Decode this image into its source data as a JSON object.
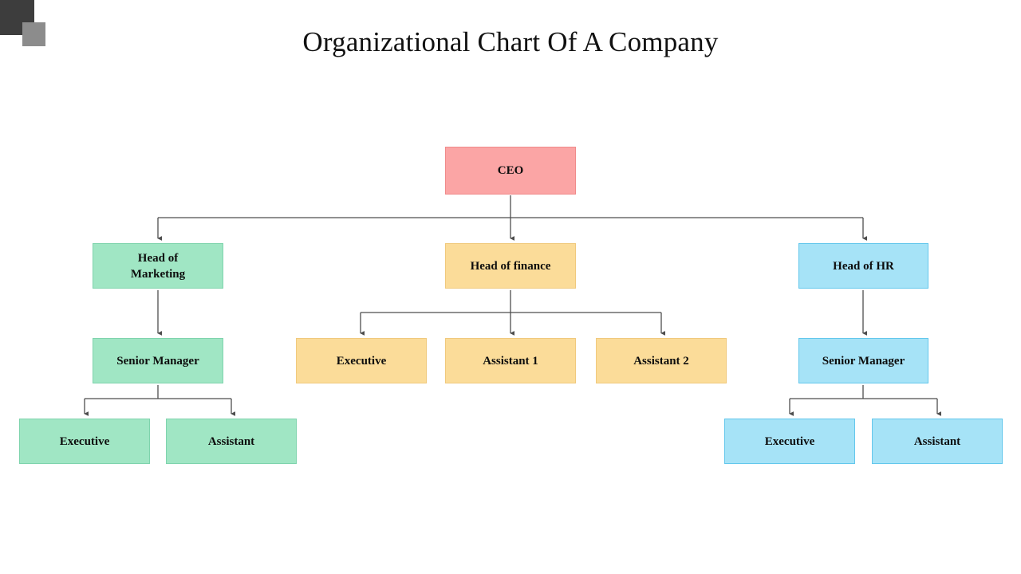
{
  "page": {
    "title": "Organizational Chart Of A Company",
    "background_color": "#ffffff"
  },
  "decoration": {
    "square_dark_color": "#3d3d3d",
    "square_gray_color": "#8c8c8c"
  },
  "palette": {
    "ceo_fill": "#fba5a5",
    "ceo_border": "#f08a8a",
    "marketing_fill": "#a0e6c4",
    "marketing_border": "#7fd4ad",
    "finance_fill": "#fbdc99",
    "finance_border": "#f0c97d",
    "hr_fill": "#a6e3f7",
    "hr_border": "#63c7ec",
    "connector_color": "#4d4d4d"
  },
  "chart_data": {
    "type": "diagram",
    "title": "Organizational Chart Of A Company",
    "nodes": [
      {
        "id": "ceo",
        "label": "CEO",
        "level": 0,
        "branch": "root",
        "color": "#fba5a5"
      },
      {
        "id": "marketing",
        "label": "Head of Marketing",
        "level": 1,
        "branch": "marketing",
        "color": "#a0e6c4"
      },
      {
        "id": "finance",
        "label": "Head of finance",
        "level": 1,
        "branch": "finance",
        "color": "#fbdc99"
      },
      {
        "id": "hr",
        "label": "Head of HR",
        "level": 1,
        "branch": "hr",
        "color": "#a6e3f7"
      },
      {
        "id": "mkt_sm",
        "label": "Senior Manager",
        "level": 2,
        "branch": "marketing",
        "color": "#a0e6c4"
      },
      {
        "id": "fin_exec",
        "label": "Executive",
        "level": 2,
        "branch": "finance",
        "color": "#fbdc99"
      },
      {
        "id": "fin_asst1",
        "label": "Assistant 1",
        "level": 2,
        "branch": "finance",
        "color": "#fbdc99"
      },
      {
        "id": "fin_asst2",
        "label": "Assistant 2",
        "level": 2,
        "branch": "finance",
        "color": "#fbdc99"
      },
      {
        "id": "hr_sm",
        "label": "Senior Manager",
        "level": 2,
        "branch": "hr",
        "color": "#a6e3f7"
      },
      {
        "id": "mkt_exec",
        "label": "Executive",
        "level": 3,
        "branch": "marketing",
        "color": "#a0e6c4"
      },
      {
        "id": "mkt_asst",
        "label": "Assistant",
        "level": 3,
        "branch": "marketing",
        "color": "#a0e6c4"
      },
      {
        "id": "hr_exec",
        "label": "Executive",
        "level": 3,
        "branch": "hr",
        "color": "#a6e3f7"
      },
      {
        "id": "hr_asst",
        "label": "Assistant",
        "level": 3,
        "branch": "hr",
        "color": "#a6e3f7"
      }
    ],
    "edges": [
      {
        "from": "ceo",
        "to": "marketing"
      },
      {
        "from": "ceo",
        "to": "finance"
      },
      {
        "from": "ceo",
        "to": "hr"
      },
      {
        "from": "marketing",
        "to": "mkt_sm"
      },
      {
        "from": "finance",
        "to": "fin_exec"
      },
      {
        "from": "finance",
        "to": "fin_asst1"
      },
      {
        "from": "finance",
        "to": "fin_asst2"
      },
      {
        "from": "hr",
        "to": "hr_sm"
      },
      {
        "from": "mkt_sm",
        "to": "mkt_exec"
      },
      {
        "from": "mkt_sm",
        "to": "mkt_asst"
      },
      {
        "from": "hr_sm",
        "to": "hr_exec"
      },
      {
        "from": "hr_sm",
        "to": "hr_asst"
      }
    ]
  },
  "nodes": {
    "ceo": {
      "label": "CEO"
    },
    "marketing": {
      "line1": "Head of",
      "line2": "Marketing"
    },
    "finance": {
      "label": "Head of finance"
    },
    "hr": {
      "label": "Head of HR"
    },
    "mkt_sm": {
      "label": "Senior Manager"
    },
    "fin_exec": {
      "label": "Executive"
    },
    "fin_asst1": {
      "label": "Assistant 1"
    },
    "fin_asst2": {
      "label": "Assistant 2"
    },
    "hr_sm": {
      "label": "Senior Manager"
    },
    "mkt_exec": {
      "label": "Executive"
    },
    "mkt_asst": {
      "label": "Assistant"
    },
    "hr_exec": {
      "label": "Executive"
    },
    "hr_asst": {
      "label": "Assistant"
    }
  }
}
